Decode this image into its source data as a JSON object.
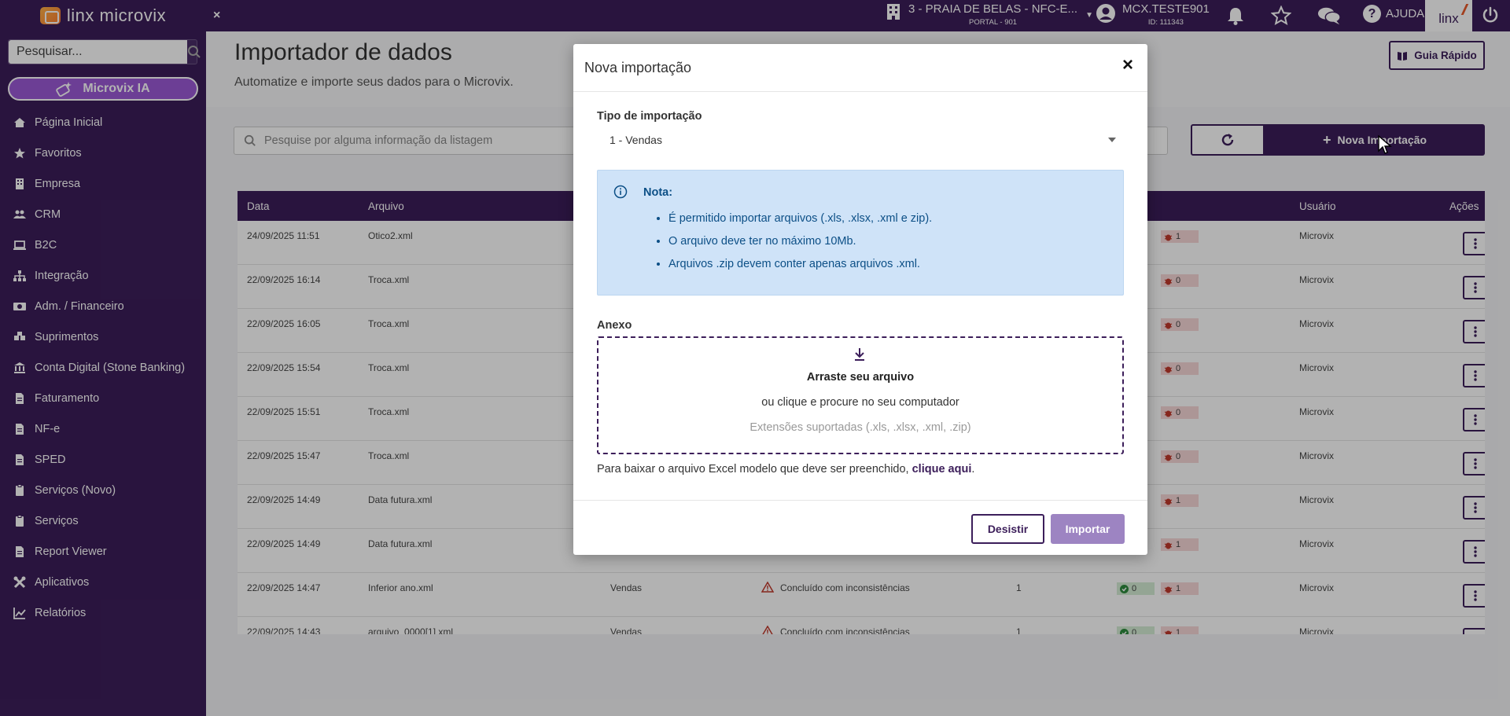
{
  "topbar": {
    "brand": "linx microvix",
    "close_glyph": "×",
    "store_name": "3 - PRAIA DE BELAS - NFC-E...",
    "store_sub": "PORTAL - 901",
    "user_name": "MCX.TESTE901",
    "user_id": "ID: 111343",
    "help_label": "AJUDA",
    "help_glyph": "?",
    "linx_logo": "linx",
    "icons": [
      "building-icon",
      "user-circle-icon",
      "bell-icon",
      "star-icon",
      "chat-icon",
      "help-icon",
      "power-icon"
    ]
  },
  "sidebar": {
    "search_placeholder": "Pesquisar...",
    "ia_button": "Microvix IA",
    "items": [
      {
        "label": "Página Inicial",
        "icon": "home-icon"
      },
      {
        "label": "Favoritos",
        "icon": "star-icon"
      },
      {
        "label": "Empresa",
        "icon": "building-icon"
      },
      {
        "label": "CRM",
        "icon": "users-icon"
      },
      {
        "label": "B2C",
        "icon": "laptop-icon"
      },
      {
        "label": "Integração",
        "icon": "sitemap-icon"
      },
      {
        "label": "Adm. / Financeiro",
        "icon": "money-icon"
      },
      {
        "label": "Suprimentos",
        "icon": "boxes-icon"
      },
      {
        "label": "Conta Digital (Stone Banking)",
        "icon": "bank-icon"
      },
      {
        "label": "Faturamento",
        "icon": "file-icon"
      },
      {
        "label": "NF-e",
        "icon": "file-icon"
      },
      {
        "label": "SPED",
        "icon": "file-icon"
      },
      {
        "label": "Serviços (Novo)",
        "icon": "clipboard-icon"
      },
      {
        "label": "Serviços",
        "icon": "clipboard-icon"
      },
      {
        "label": "Report Viewer",
        "icon": "file-icon"
      },
      {
        "label": "Aplicativos",
        "icon": "tools-icon"
      },
      {
        "label": "Relatórios",
        "icon": "chart-icon"
      }
    ]
  },
  "page": {
    "title": "Importador de dados",
    "subtitle": "Automatize e importe seus dados para o Microvix.",
    "guide_button": "Guia Rápido",
    "list_search_placeholder": "Pesquise por alguma informação da listagem",
    "new_button": "Nova Importação"
  },
  "table": {
    "headers": {
      "data": "Data",
      "arquivo": "Arquivo",
      "usuario": "Usuário",
      "acoes": "Ações"
    },
    "rows": [
      {
        "data": "24/09/2025 11:51",
        "arquivo": "Otico2.xml",
        "tipo": "",
        "status": "",
        "qtd": "",
        "ok": "",
        "err": "1",
        "usuario": "Microvix"
      },
      {
        "data": "22/09/2025 16:14",
        "arquivo": "Troca.xml",
        "tipo": "",
        "status": "",
        "qtd": "",
        "ok": "",
        "err": "0",
        "usuario": "Microvix"
      },
      {
        "data": "22/09/2025 16:05",
        "arquivo": "Troca.xml",
        "tipo": "",
        "status": "",
        "qtd": "",
        "ok": "",
        "err": "0",
        "usuario": "Microvix"
      },
      {
        "data": "22/09/2025 15:54",
        "arquivo": "Troca.xml",
        "tipo": "",
        "status": "",
        "qtd": "",
        "ok": "",
        "err": "0",
        "usuario": "Microvix"
      },
      {
        "data": "22/09/2025 15:51",
        "arquivo": "Troca.xml",
        "tipo": "",
        "status": "",
        "qtd": "",
        "ok": "",
        "err": "0",
        "usuario": "Microvix"
      },
      {
        "data": "22/09/2025 15:47",
        "arquivo": "Troca.xml",
        "tipo": "",
        "status": "",
        "qtd": "",
        "ok": "",
        "err": "0",
        "usuario": "Microvix"
      },
      {
        "data": "22/09/2025 14:49",
        "arquivo": "Data futura.xml",
        "tipo": "",
        "status": "",
        "qtd": "",
        "ok": "",
        "err": "1",
        "usuario": "Microvix"
      },
      {
        "data": "22/09/2025 14:49",
        "arquivo": "Data futura.xml",
        "tipo": "",
        "status": "",
        "qtd": "",
        "ok": "",
        "err": "1",
        "usuario": "Microvix"
      },
      {
        "data": "22/09/2025 14:47",
        "arquivo": "Inferior ano.xml",
        "tipo": "Vendas",
        "status": "Concluído com inconsistências",
        "qtd": "1",
        "ok": "0",
        "err": "1",
        "usuario": "Microvix"
      },
      {
        "data": "22/09/2025 14:43",
        "arquivo": "arquivo_0000[1] xml",
        "tipo": "Vendas",
        "status": "Concluído com inconsistências",
        "qtd": "1",
        "ok": "0",
        "err": "1",
        "usuario": "Microvix"
      }
    ]
  },
  "modal": {
    "title": "Nova importação",
    "close_glyph": "×",
    "type_label": "Tipo de importação",
    "type_value": "1 - Vendas",
    "note_title": "Nota:",
    "note_items": [
      "É permitido importar arquivos (.xls, .xlsx, .xml e zip).",
      "O arquivo deve ter no máximo 10Mb.",
      "Arquivos .zip devem conter apenas arquivos .xml."
    ],
    "attach_label": "Anexo",
    "drop_title": "Arraste seu arquivo",
    "drop_sub": "ou clique e procure no seu computador",
    "drop_ext": "Extensões suportadas (.xls, .xlsx, .xml, .zip)",
    "download_text": "Para baixar o arquivo Excel modelo que deve ser preenchido,",
    "download_link": "clique aqui",
    "download_end": ".",
    "cancel_button": "Desistir",
    "import_button": "Importar"
  },
  "colors": {
    "brand": "#3c1e5a",
    "accent": "#9b59d6",
    "note_bg": "#cfe3f8"
  }
}
